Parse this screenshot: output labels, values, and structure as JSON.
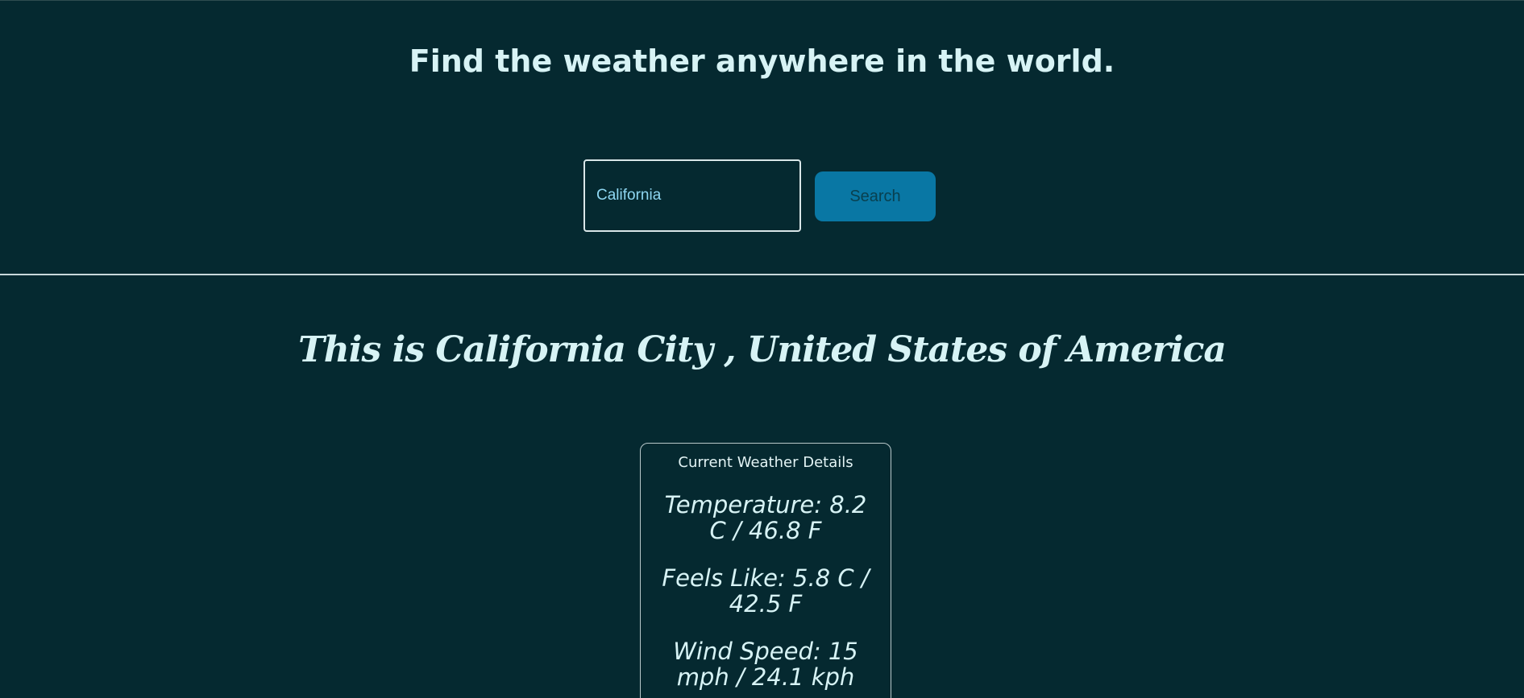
{
  "header": {
    "title": "Find the weather anywhere in the world."
  },
  "search": {
    "value": "California",
    "button_label": "Search"
  },
  "location": {
    "heading": "This is California City , United States of America"
  },
  "weather_card": {
    "title": "Current Weather Details",
    "temperature": "Temperature: 8.2 C / 46.8 F",
    "feels_like": "Feels Like: 5.8 C / 42.5 F",
    "wind_speed": "Wind Speed: 15 mph / 24.1 kph"
  },
  "colors": {
    "background": "#052930",
    "text": "#d7f3f5",
    "button": "#0977a4"
  }
}
